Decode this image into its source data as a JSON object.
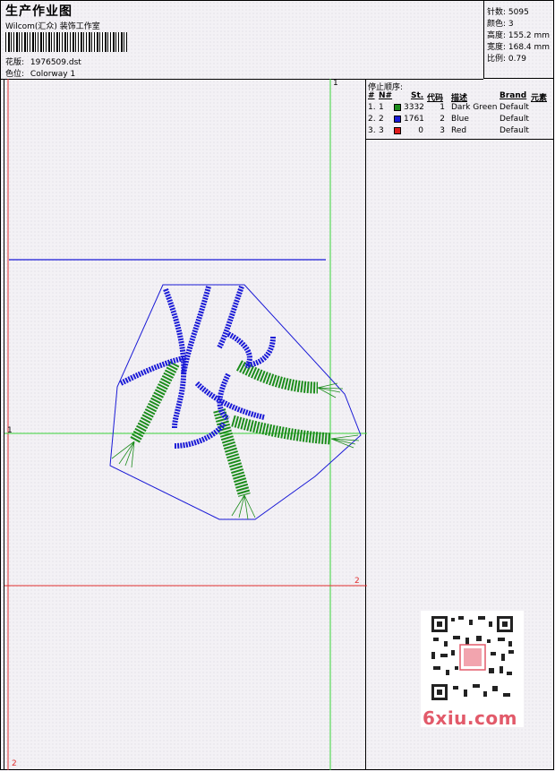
{
  "header": {
    "title": "生产作业图",
    "company": "Wilcom(汇众) 装饰工作室",
    "design_label": "花版:",
    "design_value": "1976509.dst",
    "colorway_label": "色位:",
    "colorway_value": "Colorway 1"
  },
  "stats": {
    "stitches": "针数: 5095",
    "colors": "颜色: 3",
    "height": "高度: 155.2 mm",
    "width": "宽度: 168.4 mm",
    "scale": "比例: 0.79"
  },
  "stop_sequence": {
    "title": "停止顺序:",
    "headers": {
      "num": "#",
      "needle": "N#",
      "stitches": "St.",
      "code": "代码",
      "description": "描述",
      "brand": "Brand",
      "element": "元素"
    },
    "rows": [
      {
        "num": "1.",
        "needle": "1",
        "color": "#1c8c1c",
        "stitches": "3332",
        "code": "1",
        "description": "Dark Green",
        "brand": "Default"
      },
      {
        "num": "2.",
        "needle": "2",
        "color": "#1a1ad6",
        "stitches": "1761",
        "code": "2",
        "description": "Blue",
        "brand": "Default"
      },
      {
        "num": "3.",
        "needle": "3",
        "color": "#e01a1a",
        "stitches": "0",
        "code": "3",
        "description": "Red",
        "brand": "Default"
      }
    ]
  },
  "axis_labels": {
    "green_top": "1",
    "green_left": "1",
    "red_right": "2",
    "red_bottom": "2"
  },
  "watermark": "6xiu.com",
  "colors": {
    "green": "#1c8c1c",
    "blue": "#1a1ad6",
    "red": "#e01a1a",
    "guide_green": "#39d439",
    "guide_red": "#e03030"
  }
}
